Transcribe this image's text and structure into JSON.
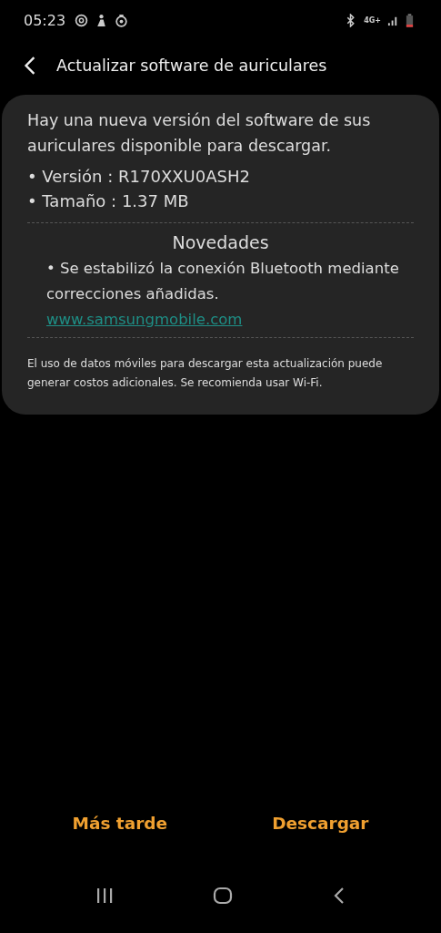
{
  "status_bar": {
    "time": "05:23",
    "network": "4G+"
  },
  "header": {
    "title": "Actualizar software de auriculares"
  },
  "card": {
    "intro": "Hay una nueva versión del software de sus auriculares disponible para descargar.",
    "details": [
      "• Versión : R170XXU0ASH2",
      "• Tamaño : 1.37 MB"
    ],
    "news_title": "Novedades",
    "news": [
      "• Se estabilizó la conexión Bluetooth mediante correcciones añadidas."
    ],
    "link": "www.samsungmobile.com",
    "note": "El uso de datos móviles para descargar esta actualización puede generar costos adicionales. Se recomienda usar Wi-Fi."
  },
  "buttons": [
    "Más tarde",
    "Descargar"
  ]
}
